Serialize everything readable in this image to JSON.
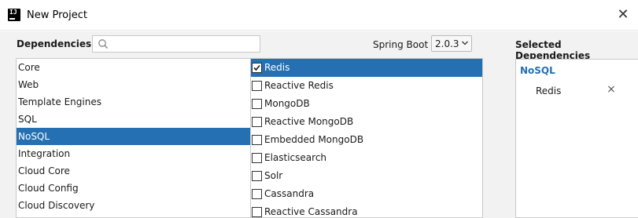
{
  "window": {
    "title": "New Project",
    "close_glyph": "✕"
  },
  "header": {
    "dependencies_label": "Dependencies",
    "search": {
      "value": "",
      "placeholder": ""
    },
    "spring_boot_label": "Spring Boot",
    "spring_boot_version": "2.0.3"
  },
  "categories": [
    {
      "label": "Core",
      "selected": false
    },
    {
      "label": "Web",
      "selected": false
    },
    {
      "label": "Template Engines",
      "selected": false
    },
    {
      "label": "SQL",
      "selected": false
    },
    {
      "label": "NoSQL",
      "selected": true
    },
    {
      "label": "Integration",
      "selected": false
    },
    {
      "label": "Cloud Core",
      "selected": false
    },
    {
      "label": "Cloud Config",
      "selected": false
    },
    {
      "label": "Cloud Discovery",
      "selected": false
    }
  ],
  "dependencies": [
    {
      "label": "Redis",
      "checked": true,
      "selected": true
    },
    {
      "label": "Reactive Redis",
      "checked": false,
      "selected": false
    },
    {
      "label": "MongoDB",
      "checked": false,
      "selected": false
    },
    {
      "label": "Reactive MongoDB",
      "checked": false,
      "selected": false
    },
    {
      "label": "Embedded MongoDB",
      "checked": false,
      "selected": false
    },
    {
      "label": "Elasticsearch",
      "checked": false,
      "selected": false
    },
    {
      "label": "Solr",
      "checked": false,
      "selected": false
    },
    {
      "label": "Cassandra",
      "checked": false,
      "selected": false
    },
    {
      "label": "Reactive Cassandra",
      "checked": false,
      "selected": false
    }
  ],
  "selected_panel": {
    "title": "Selected Dependencies",
    "category": "NoSQL",
    "items": [
      {
        "label": "Redis",
        "remove_glyph": "×"
      }
    ]
  },
  "colors": {
    "selection": "#2470b3",
    "category_heading": "#2470b3",
    "panel_background": "#f2f2f2"
  },
  "icons": {
    "app": "intellij-idea-icon",
    "search": "search-icon",
    "dropdown": "chevron-down-icon",
    "close": "close-icon",
    "checkbox": "checkbox-icon"
  }
}
